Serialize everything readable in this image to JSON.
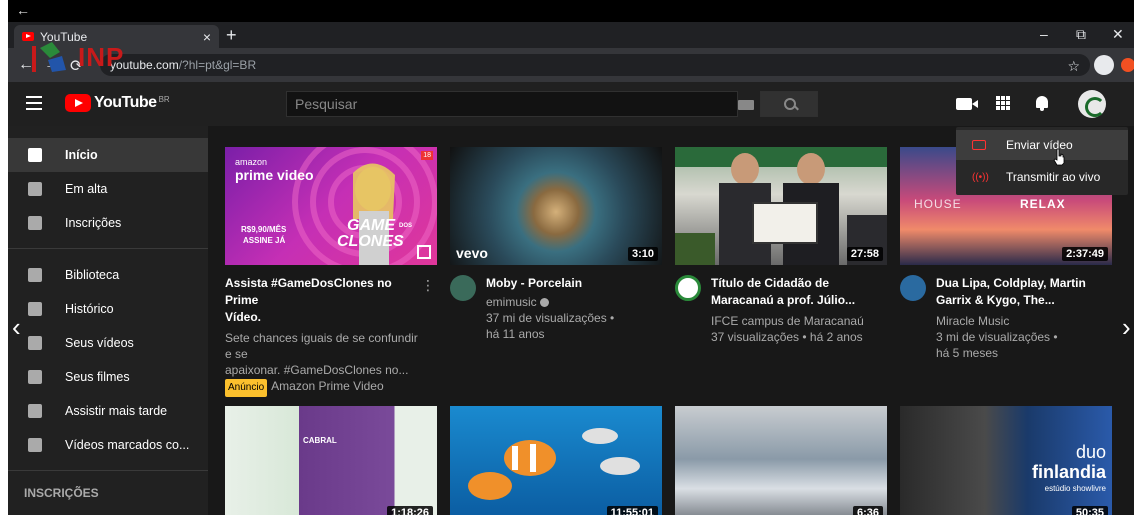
{
  "browser": {
    "back_arrow": "←",
    "tab_title": "YouTube",
    "tab_close": "×",
    "new_tab": "+",
    "controls": {
      "minimize": "–",
      "restore": "⧉",
      "close": "✕"
    },
    "nav": {
      "back": "←",
      "forward": "→",
      "reload": "⟳"
    },
    "url_domain": "youtube.com",
    "url_path": "/?hl=pt&gl=BR",
    "star": "☆",
    "watermark_text": "INP"
  },
  "header": {
    "logo_text": "YouTube",
    "logo_region": "BR",
    "search_placeholder": "Pesquisar"
  },
  "sidebar": {
    "items": [
      {
        "label": "Início",
        "icon": "home-icon",
        "active": true
      },
      {
        "label": "Em alta",
        "icon": "flame-icon"
      },
      {
        "label": "Inscrições",
        "icon": "subscriptions-icon"
      },
      {
        "label": "Biblioteca",
        "icon": "library-icon"
      },
      {
        "label": "Histórico",
        "icon": "history-icon"
      },
      {
        "label": "Seus vídeos",
        "icon": "your-videos-icon"
      },
      {
        "label": "Seus filmes",
        "icon": "film-icon"
      },
      {
        "label": "Assistir mais tarde",
        "icon": "clock-icon"
      },
      {
        "label": "Vídeos marcados co...",
        "icon": "thumbs-up-icon"
      }
    ],
    "subscriptions_heading": "INSCRIÇÕES"
  },
  "videos": [
    {
      "title_1": "Assista #GameDosClones no Prime",
      "title_2": "Vídeo.",
      "line_1": "Sete chances iguais de se confundir e se",
      "line_2": "apaixonar. #GameDosClones no...",
      "ad_label": "Anúncio",
      "channel": "Amazon Prime Video",
      "thumb_brand": "amazon",
      "thumb_service": "prime video",
      "thumb_game": "GAME",
      "thumb_clones": "CLONES",
      "thumb_dos": "DOS",
      "thumb_price": "R$9,90/MÊS",
      "thumb_cta": "ASSINE JÁ",
      "thumb_rating": "18"
    },
    {
      "title_1": "Moby - Porcelain",
      "channel": "emimusic",
      "views": "37 mi de visualizações •",
      "age": "há 11 anos",
      "duration": "3:10",
      "watermark": "vevo"
    },
    {
      "title_1": "Título de Cidadão de",
      "title_2": "Maracanaú a prof. Júlio...",
      "channel": "IFCE campus de Maracanaú",
      "views": "37 visualizações • há 2 anos",
      "duration": "27:58"
    },
    {
      "title_1": "Dua Lipa, Coldplay, Martin",
      "title_2": "Garrix & Kygo, The...",
      "channel": "Miracle Music",
      "views": "3 mi de visualizações •",
      "age": "há 5 meses",
      "duration": "2:37:49",
      "thumb_left": "HOUSE",
      "thumb_right": "RELAX"
    }
  ],
  "second_row": [
    {
      "duration": "1:18:26",
      "thumb_text": "CABRAL"
    },
    {
      "duration": "11:55:01"
    },
    {
      "duration": "6:36"
    },
    {
      "duration": "50:35",
      "thumb_duo": "duo",
      "thumb_name": "finlandia",
      "thumb_sub": "estúdio showlivre"
    }
  ],
  "create_menu": [
    {
      "label": "Enviar vídeo",
      "icon": "upload-video-icon"
    },
    {
      "label": "Transmitir ao vivo",
      "icon": "live-icon"
    }
  ],
  "colors": {
    "brand": "#ff0000",
    "background": "#181818",
    "sidebar": "#212121",
    "header": "#202020",
    "ad_badge": "#fbc02d"
  }
}
